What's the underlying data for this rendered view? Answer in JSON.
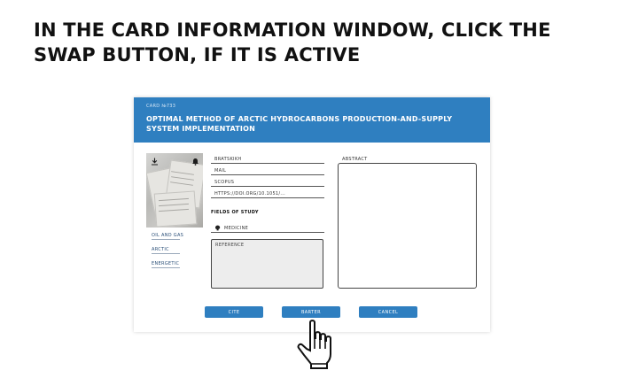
{
  "instruction": {
    "line1": "IN THE CARD INFORMATION WINDOW, CLICK THE",
    "line2": "SWAP BUTTON, IF IT IS ACTIVE"
  },
  "card": {
    "number": "CARD №733",
    "title_line1": "OPTIMAL METHOD OF ARCTIC HYDROCARBONS PRODUCTION-AND-SUPPLY",
    "title_line2": "SYSTEM IMPLEMENTATION",
    "fields": {
      "author": "BRATSKIKH",
      "mail": "MAIL",
      "scopus": "SCOPUS",
      "doi": "HTTPS://DOI.ORG/10.1051/..."
    },
    "fields_of_study_label": "FIELDS OF STUDY",
    "field_of_study": "MEDICINE",
    "reference_placeholder": "REFERENCE",
    "abstract_label": "ABSTRACT",
    "left_links": [
      "OIL AND GAS",
      "ARCTIC",
      "ENERGETIC"
    ],
    "buttons": {
      "cite": "CITE",
      "barter": "BARTER",
      "cancel": "CANCEL"
    }
  },
  "icons": {
    "download": "download-icon",
    "bell": "bell-icon",
    "field_icon": "brain-icon",
    "cursor": "hand-pointer-icon"
  },
  "colors": {
    "accent": "#2f7fc0",
    "header_text": "#ffffff"
  }
}
